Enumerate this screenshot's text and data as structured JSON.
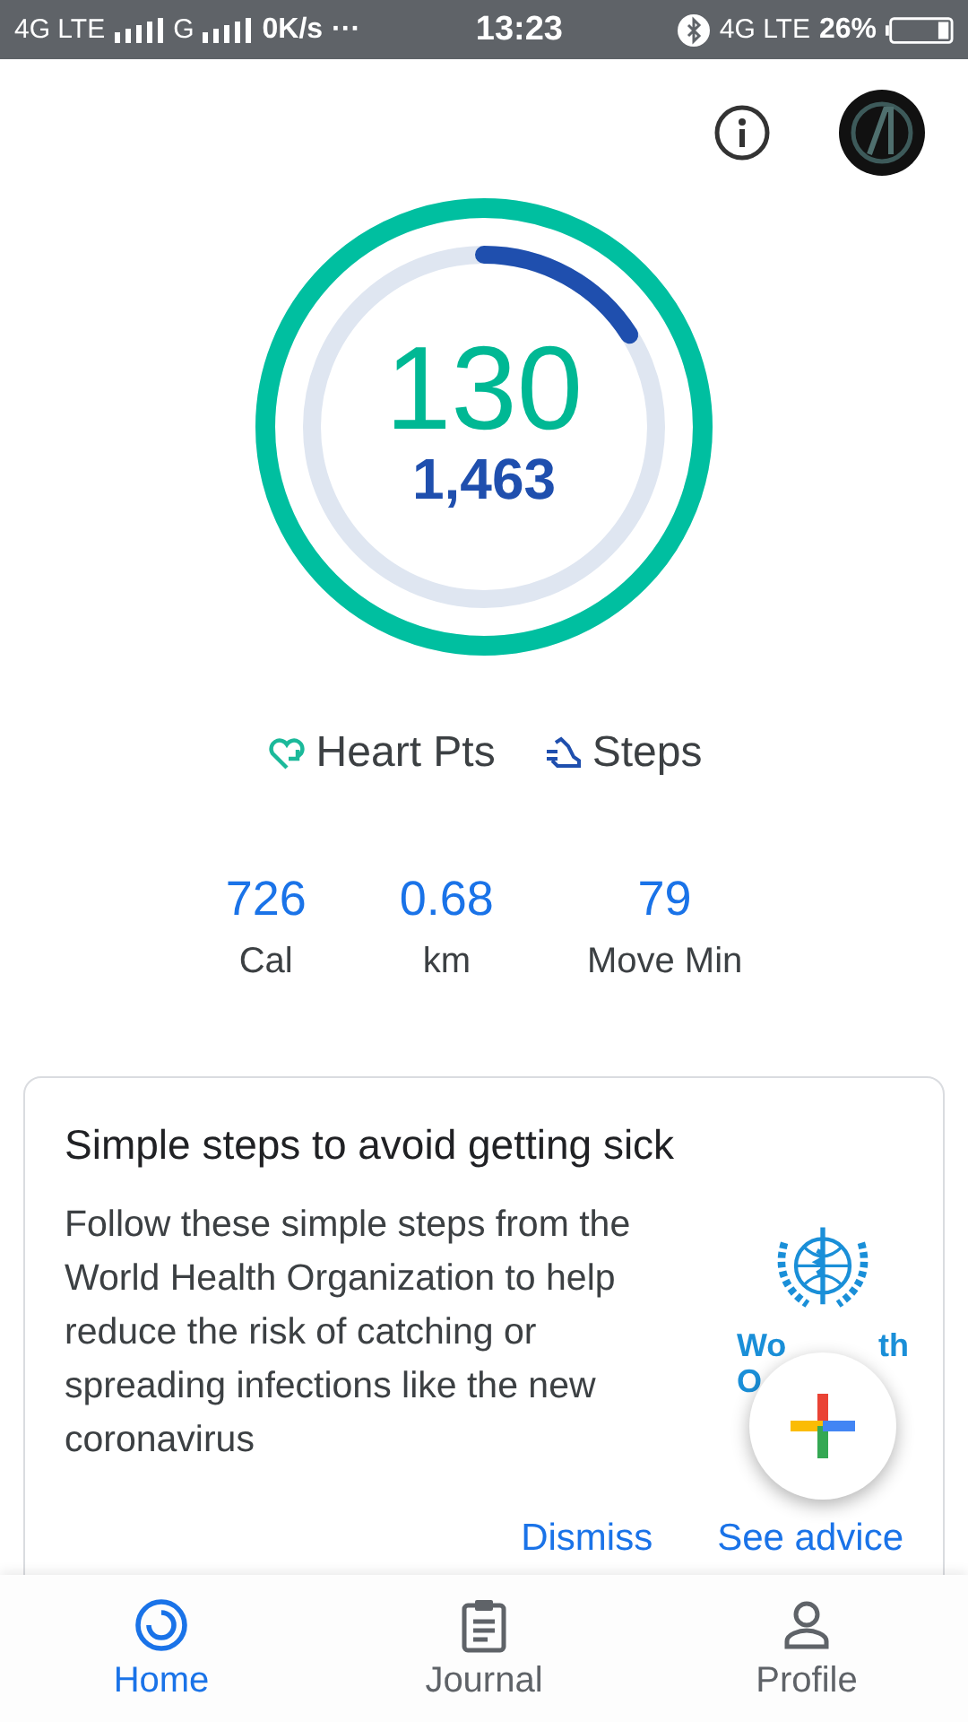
{
  "status_bar": {
    "network_1": "4G LTE",
    "network_2": "G",
    "speed": "0K/s",
    "more": "···",
    "time": "13:23",
    "network_3": "4G LTE",
    "battery": "26%"
  },
  "rings": {
    "heart": {
      "value": "130",
      "level": 1
    },
    "steps": {
      "value": "1,463",
      "level": 0.16
    }
  },
  "legend": [
    {
      "kind": "heart",
      "label": "Heart Pts"
    },
    {
      "kind": "steps",
      "label": "Steps"
    }
  ],
  "stats": [
    {
      "value": "726",
      "label": "Cal"
    },
    {
      "value": "0.68",
      "label": "km"
    },
    {
      "value": "79",
      "label": "Move Min"
    }
  ],
  "card": {
    "title": "Simple steps to avoid getting sick",
    "body": "Follow these simple steps from the World Health Organization to help reduce the risk of catching or spreading infections like the new coronavirus",
    "logo_text": [
      "Wo",
      "th",
      "O"
    ],
    "actions": [
      "Dismiss",
      "See advice"
    ]
  },
  "bottom_nav": [
    {
      "kind": "home",
      "label": "Home",
      "selected": true
    },
    {
      "kind": "journal",
      "label": "Journal",
      "selected": false
    },
    {
      "kind": "profile",
      "label": "Profile",
      "selected": false
    }
  ]
}
